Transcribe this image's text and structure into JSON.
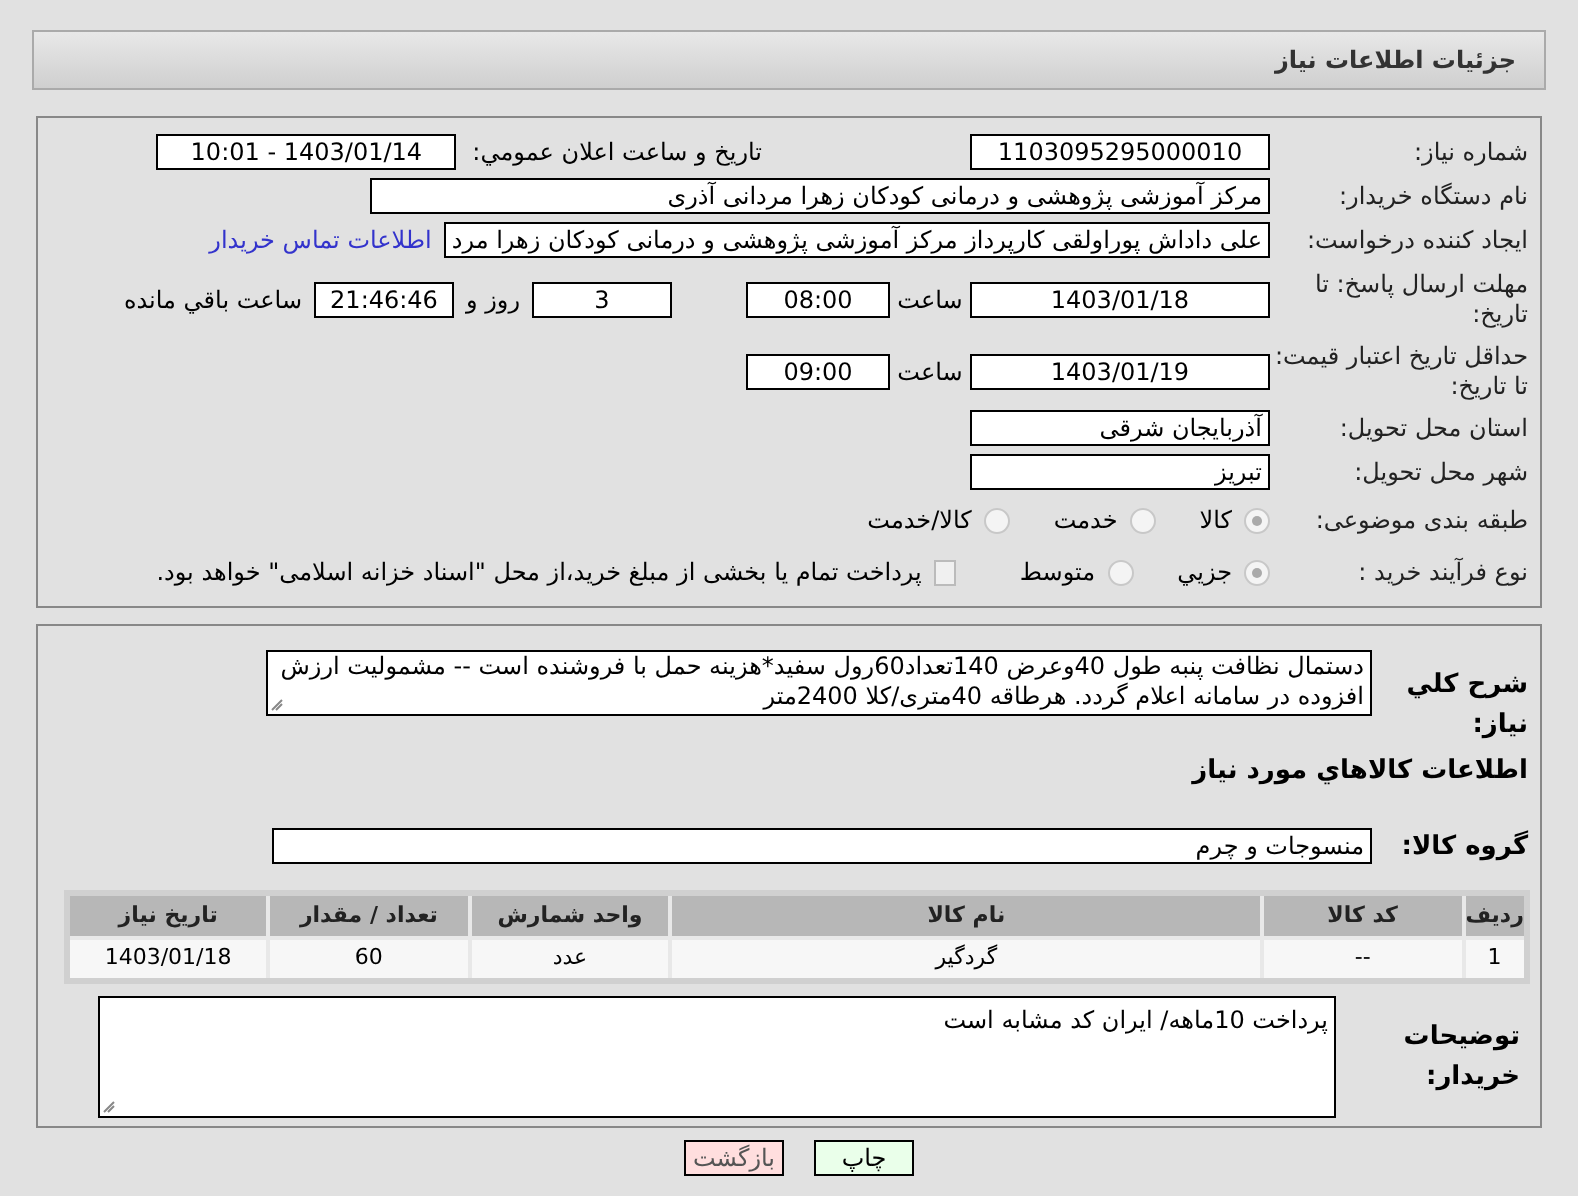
{
  "header": {
    "title": "جزئیات اطلاعات نیاز"
  },
  "need_number": {
    "label": "شماره نیاز:",
    "value": "1103095295000010"
  },
  "announce": {
    "label": "تاریخ و ساعت اعلان عمومي:",
    "value": "1403/01/14 - 10:01"
  },
  "buyer_org": {
    "label": "نام دستگاه خریدار:",
    "value": "مرکز آموزشی پژوهشی و درمانی کودکان زهرا مردانی آذری"
  },
  "creator": {
    "label": "ایجاد کننده درخواست:",
    "value": "علی داداش پوراولقی کارپرداز مرکز آموزشی پژوهشی و درمانی کودکان زهرا مرد",
    "link": "اطلاعات تماس خریدار"
  },
  "reply_deadline": {
    "label": "مهلت ارسال پاسخ: تا تاریخ:",
    "date": "1403/01/18",
    "time_label": "ساعت",
    "time": "08:00",
    "days": "3",
    "days_label": "روز و",
    "remaining": "21:46:46",
    "remaining_label": "ساعت باقي مانده"
  },
  "price_validity": {
    "label": "حداقل تاریخ اعتبار قیمت: تا تاریخ:",
    "date": "1403/01/19",
    "time_label": "ساعت",
    "time": "09:00"
  },
  "province": {
    "label": "استان محل تحویل:",
    "value": "آذربایجان شرقی"
  },
  "city": {
    "label": "شهر محل تحویل:",
    "value": "تبریز"
  },
  "category": {
    "label": "طبقه بندی موضوعی:",
    "options": [
      {
        "label": "کالا",
        "selected": true
      },
      {
        "label": "خدمت",
        "selected": false
      },
      {
        "label": "کالا/خدمت",
        "selected": false
      }
    ]
  },
  "purchase_type": {
    "label": "نوع فرآیند خرید :",
    "options": [
      {
        "label": "جزیي",
        "selected": true
      },
      {
        "label": "متوسط",
        "selected": false
      }
    ],
    "treasury": {
      "label": "پرداخت تمام یا بخشی از مبلغ خرید،از محل \"اسناد خزانه اسلامی\" خواهد بود.",
      "checked": false
    }
  },
  "description": {
    "label": "شرح کلي نیاز:",
    "value": "دستمال نظافت پنبه طول 40وعرض 140تعداد60رول سفید*هزینه حمل با فروشنده است -- مشمولیت ارزش افزوده در سامانه  اعلام  گردد.  هرطاقه 40متری/کلا 2400متر"
  },
  "goods_heading": "اطلاعات کالاهاي مورد نیاز",
  "goods_group": {
    "label": "گروه کالا:",
    "value": "منسوجات و چرم"
  },
  "table": {
    "columns": [
      "ردیف",
      "کد کالا",
      "نام کالا",
      "واحد شمارش",
      "تعداد / مقدار",
      "تاریخ نیاز"
    ],
    "rows": [
      [
        "1",
        "--",
        "گردگیر",
        "عدد",
        "60",
        "1403/01/18"
      ]
    ]
  },
  "buyer_notes": {
    "label": "توضیحات خریدار:",
    "value": "پرداخت 10ماهه/ ایران کد مشابه است"
  },
  "buttons": [
    {
      "label": "چاپ",
      "kind": "print"
    },
    {
      "label": "بازگشت",
      "kind": "back"
    }
  ]
}
